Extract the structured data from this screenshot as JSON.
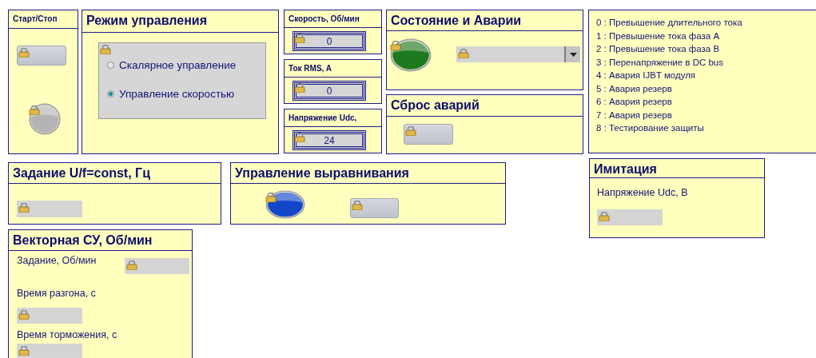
{
  "panels": [
    {
      "title": "Старт/Стоп",
      "items": [
        {
          "kind": "button"
        },
        {
          "kind": "lamp",
          "color": "#b4b4b4"
        }
      ]
    },
    {
      "title": "Режим управления",
      "items": [
        {
          "kind": "radio_group",
          "options": [
            {
              "label": "Скалярное управление",
              "selected": false
            },
            {
              "label": "Управление скоростью",
              "selected": true
            }
          ]
        }
      ]
    },
    {
      "title": "Скорость, Об/мин",
      "items": [
        {
          "kind": "readout",
          "value": "0"
        }
      ]
    },
    {
      "title": "Ток RMS, A",
      "items": [
        {
          "kind": "readout",
          "value": "0"
        }
      ]
    },
    {
      "title": "Напряжение Udc,",
      "items": [
        {
          "kind": "readout",
          "value": "24"
        }
      ]
    },
    {
      "title": "Состояние и Аварии",
      "items": [
        {
          "kind": "lamp",
          "color": "#1e7a1e"
        },
        {
          "kind": "dropdown"
        }
      ]
    },
    {
      "title": "Сброс аварий",
      "items": [
        {
          "kind": "button"
        }
      ]
    },
    {
      "items": [
        {
          "kind": "list",
          "entries": [
            "0 : Превышение длительного тока",
            "1 : Превышение тока фаза А",
            "2 : Превышение тока фаза В",
            "3 : Перенапряжение в DC bus",
            "4 : Авария IJBT модуля",
            "5 : Авария резерв",
            "6 : Авария резерв",
            "7 : Авария резерв",
            "8 : Тестирование защиты"
          ]
        }
      ]
    },
    {
      "title": "Задание U/f=const, Гц",
      "items": [
        {
          "kind": "field"
        }
      ]
    },
    {
      "title": "Управление выравнивания",
      "items": [
        {
          "kind": "lamp",
          "color": "#1447c8"
        },
        {
          "kind": "button"
        }
      ]
    },
    {
      "title": "Имитация",
      "items": [
        {
          "kind": "label",
          "text": "Напряжение Udc, В"
        },
        {
          "kind": "field"
        }
      ]
    },
    {
      "title": "Векторная СУ, Об/мин",
      "items": [
        {
          "kind": "label",
          "text": "Задание, Об/мин"
        },
        {
          "kind": "field"
        },
        {
          "kind": "label",
          "text": "Время разгона, с"
        },
        {
          "kind": "field"
        },
        {
          "kind": "label",
          "text": "Время торможения, с"
        },
        {
          "kind": "field"
        }
      ]
    }
  ]
}
